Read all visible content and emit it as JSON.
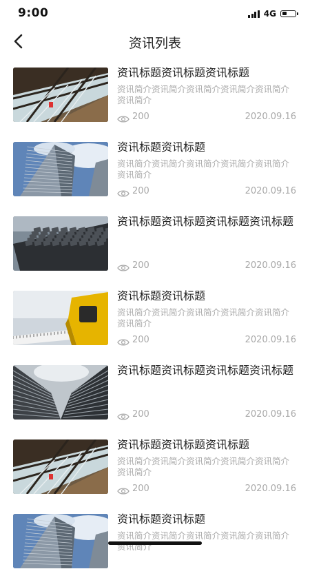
{
  "status_bar": {
    "time": "9:00",
    "network": "4G"
  },
  "header": {
    "title": "资讯列表",
    "back_icon": "chevron-left-icon"
  },
  "news": [
    {
      "image": "bridge-structure",
      "title": "资讯标题资讯标题资讯标题",
      "summary": "资讯简介资讯简介资讯简介资讯简介资讯简介资讯简介",
      "views": "200",
      "date": "2020.09.16"
    },
    {
      "image": "skyscraper",
      "title": "资讯标题资讯标题",
      "summary": "资讯简介资讯简介资讯简介资讯简介资讯简介资讯简介",
      "views": "200",
      "date": "2020.09.16"
    },
    {
      "image": "keyboard",
      "title": "资讯标题资讯标题资讯标题资讯标题",
      "summary": "",
      "views": "200",
      "date": "2020.09.16"
    },
    {
      "image": "tape-measure",
      "title": "资讯标题资讯标题",
      "summary": "资讯简介资讯简介资讯简介资讯简介资讯简介资讯简介",
      "views": "200",
      "date": "2020.09.16"
    },
    {
      "image": "buildings-up",
      "title": "资讯标题资讯标题资讯标题资讯标题",
      "summary": "",
      "views": "200",
      "date": "2020.09.16"
    },
    {
      "image": "bridge-structure",
      "title": "资讯标题资讯标题资讯标题",
      "summary": "资讯简介资讯简介资讯简介资讯简介资讯简介资讯简介",
      "views": "200",
      "date": "2020.09.16"
    },
    {
      "image": "skyscraper",
      "title": "资讯标题资讯标题",
      "summary": "资讯简介资讯简介资讯简介资讯简介资讯简介资讯简介",
      "views": "",
      "date": ""
    }
  ]
}
